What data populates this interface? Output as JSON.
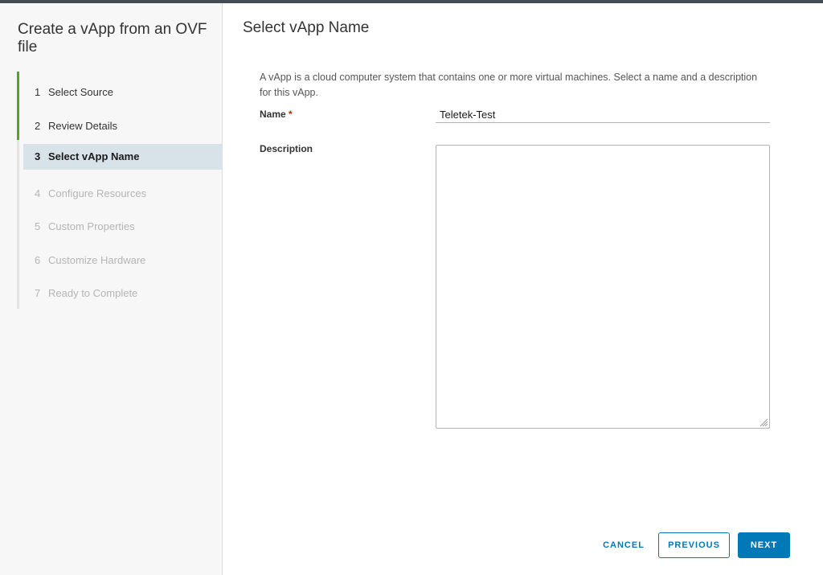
{
  "wizard": {
    "title": "Create a vApp from an OVF file",
    "steps": [
      {
        "num": "1",
        "label": "Select Source",
        "state": "done"
      },
      {
        "num": "2",
        "label": "Review Details",
        "state": "done"
      },
      {
        "num": "3",
        "label": "Select vApp Name",
        "state": "active"
      },
      {
        "num": "4",
        "label": "Configure Resources",
        "state": "todo"
      },
      {
        "num": "5",
        "label": "Custom Properties",
        "state": "todo"
      },
      {
        "num": "6",
        "label": "Customize Hardware",
        "state": "todo"
      },
      {
        "num": "7",
        "label": "Ready to Complete",
        "state": "todo"
      }
    ]
  },
  "page": {
    "title": "Select vApp Name",
    "intro": "A vApp is a cloud computer system that contains one or more virtual machines. Select a name and a description for this vApp."
  },
  "form": {
    "name_label": "Name",
    "required_marker": "*",
    "name_value": "Teletek-Test",
    "description_label": "Description",
    "description_value": ""
  },
  "footer": {
    "cancel_label": "CANCEL",
    "previous_label": "PREVIOUS",
    "next_label": "NEXT"
  },
  "colors": {
    "accent": "#0079b8",
    "completed_step": "#5aa220",
    "active_step_bg": "#d8e3e9",
    "required": "#c92100"
  }
}
